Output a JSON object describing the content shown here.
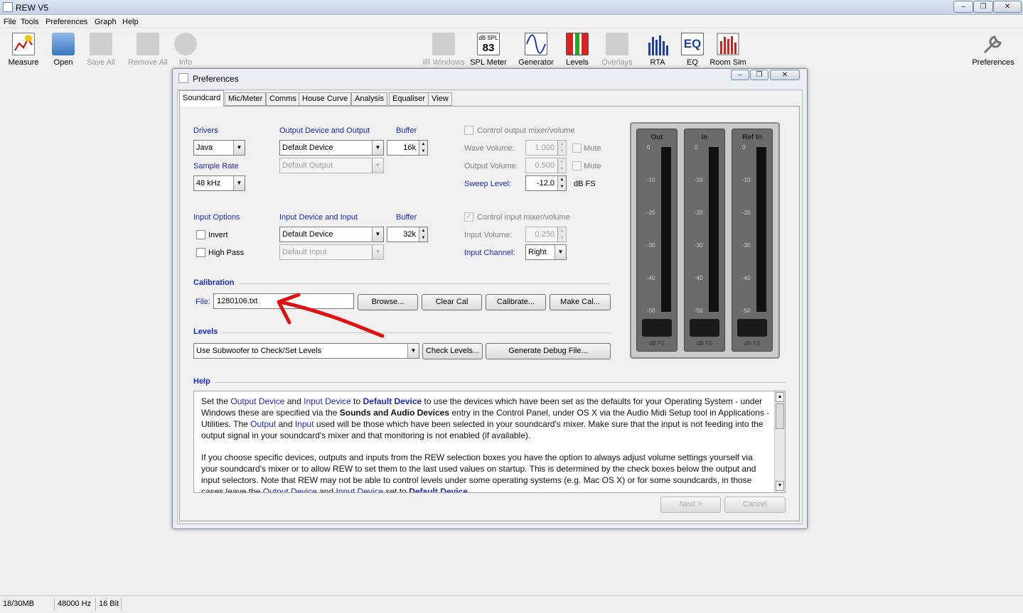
{
  "app": {
    "title": "REW V5"
  },
  "window_controls": {
    "minimize": "–",
    "restore": "❐",
    "close": "✕"
  },
  "menu": [
    "File",
    "Tools",
    "Preferences",
    "Graph",
    "Help"
  ],
  "toolbar": {
    "left": [
      {
        "label": "Measure",
        "icon": "measure-icon",
        "enabled": true
      },
      {
        "label": "Open",
        "icon": "folder-icon",
        "enabled": true
      },
      {
        "label": "Save All",
        "icon": "save-icon",
        "enabled": false
      },
      {
        "label": "Remove All",
        "icon": "remove-icon",
        "enabled": false
      },
      {
        "label": "Info",
        "icon": "info-icon",
        "enabled": false
      }
    ],
    "right": [
      {
        "label": "IR Windows",
        "icon": "ir-windows-icon",
        "enabled": false
      },
      {
        "label": "SPL Meter",
        "icon": "spl-meter-icon",
        "enabled": true,
        "badge_top": "dB SPL",
        "badge_value": "83"
      },
      {
        "label": "Generator",
        "icon": "generator-icon",
        "enabled": true
      },
      {
        "label": "Levels",
        "icon": "levels-icon",
        "enabled": true
      },
      {
        "label": "Overlays",
        "icon": "overlays-icon",
        "enabled": false
      },
      {
        "label": "RTA",
        "icon": "rta-icon",
        "enabled": true
      },
      {
        "label": "EQ",
        "icon": "eq-icon",
        "enabled": true
      },
      {
        "label": "Room Sim",
        "icon": "room-sim-icon",
        "enabled": true
      }
    ],
    "far_right": {
      "label": "Preferences",
      "icon": "wrench-icon"
    }
  },
  "dialog": {
    "title": "Preferences",
    "tabs": [
      "Soundcard",
      "Mic/Meter",
      "Comms",
      "House Curve",
      "Analysis",
      "Equaliser",
      "View"
    ],
    "selected_tab": "Soundcard",
    "drivers": {
      "label": "Drivers",
      "value": "Java"
    },
    "sample_rate": {
      "label": "Sample Rate",
      "value": "48 kHz"
    },
    "output": {
      "label": "Output Device and Output",
      "device": "Default Device",
      "channel_placeholder": "Default Output",
      "buffer_label": "Buffer",
      "buffer": "16k"
    },
    "output_mixer": {
      "checkbox_label": "Control output mixer/volume",
      "checked": false,
      "wave_volume_label": "Wave Volume:",
      "wave_volume": "1.000",
      "output_volume_label": "Output Volume:",
      "output_volume": "0.500",
      "mute_label": "Mute",
      "sweep_level_label": "Sweep Level:",
      "sweep_level": "-12.0",
      "sweep_unit": "dB FS"
    },
    "input_options": {
      "label": "Input Options",
      "invert": "Invert",
      "high_pass": "High Pass"
    },
    "input": {
      "label": "Input Device and Input",
      "device": "Default Device",
      "channel_placeholder": "Default Input",
      "buffer_label": "Buffer",
      "buffer": "32k"
    },
    "input_mixer": {
      "checkbox_label": "Control input mixer/volume",
      "checked": true,
      "input_volume_label": "Input Volume:",
      "input_volume": "0.250",
      "input_channel_label": "Input Channel:",
      "input_channel": "Right"
    },
    "calibration": {
      "section": "Calibration",
      "file_label": "File:",
      "file": "1280106.txt",
      "buttons": [
        "Browse...",
        "Clear Cal",
        "Calibrate...",
        "Make Cal..."
      ]
    },
    "levels": {
      "section": "Levels",
      "mode": "Use Subwoofer to Check/Set Levels",
      "check_button": "Check Levels...",
      "debug_button": "Generate Debug File..."
    },
    "meters": {
      "channels": [
        "Out",
        "In",
        "Ref In"
      ],
      "ticks": [
        "0",
        "-10",
        "-20",
        "-30",
        "-40",
        "-50"
      ],
      "unit": "dB FS"
    },
    "help": {
      "section": "Help",
      "p1": [
        [
          "Set the ",
          ""
        ],
        [
          "Output Device",
          "hl"
        ],
        [
          " and ",
          ""
        ],
        [
          "Input Device",
          "hl"
        ],
        [
          " to ",
          ""
        ],
        [
          "Default Device",
          "hb"
        ],
        [
          " to use the devices which have been set as the defaults for your Operating System - under Windows these are specified via the ",
          ""
        ],
        [
          "Sounds and Audio Devices",
          "b"
        ],
        [
          " entry in the Control Panel, under OS X via the Audio Midi Setup tool in Applications - Utilities. The ",
          ""
        ],
        [
          "Output",
          "hl"
        ],
        [
          " and ",
          ""
        ],
        [
          "Input",
          "hl"
        ],
        [
          " used will be those which have been selected in your soundcard's mixer. Make sure that the input is not feeding into the output signal in your soundcard's mixer and that monitoring is not enabled (if available).",
          ""
        ]
      ],
      "p2": [
        [
          "If you choose specific devices, outputs and inputs from the REW selection boxes you have the option to always adjust volume settings yourself via your soundcard's mixer or to allow REW to set them to the last used values on startup. This is determined by the check boxes below the output and input selectors. Note that REW may not be able to control levels under some operating systems (e.g. Mac OS X) or for some soundcards, in those cases leave the ",
          ""
        ],
        [
          "Output Device",
          "hl"
        ],
        [
          " and ",
          ""
        ],
        [
          "Input Device",
          "hl"
        ],
        [
          " set to ",
          ""
        ],
        [
          "Default Device",
          "hb"
        ]
      ]
    },
    "buttons": {
      "next": "Next >",
      "cancel": "Cancel"
    }
  },
  "status": {
    "memory": "18/30MB",
    "sample_rate": "48000 Hz",
    "bits": "16 Bit"
  },
  "annotation": {
    "color": "#e01010"
  }
}
